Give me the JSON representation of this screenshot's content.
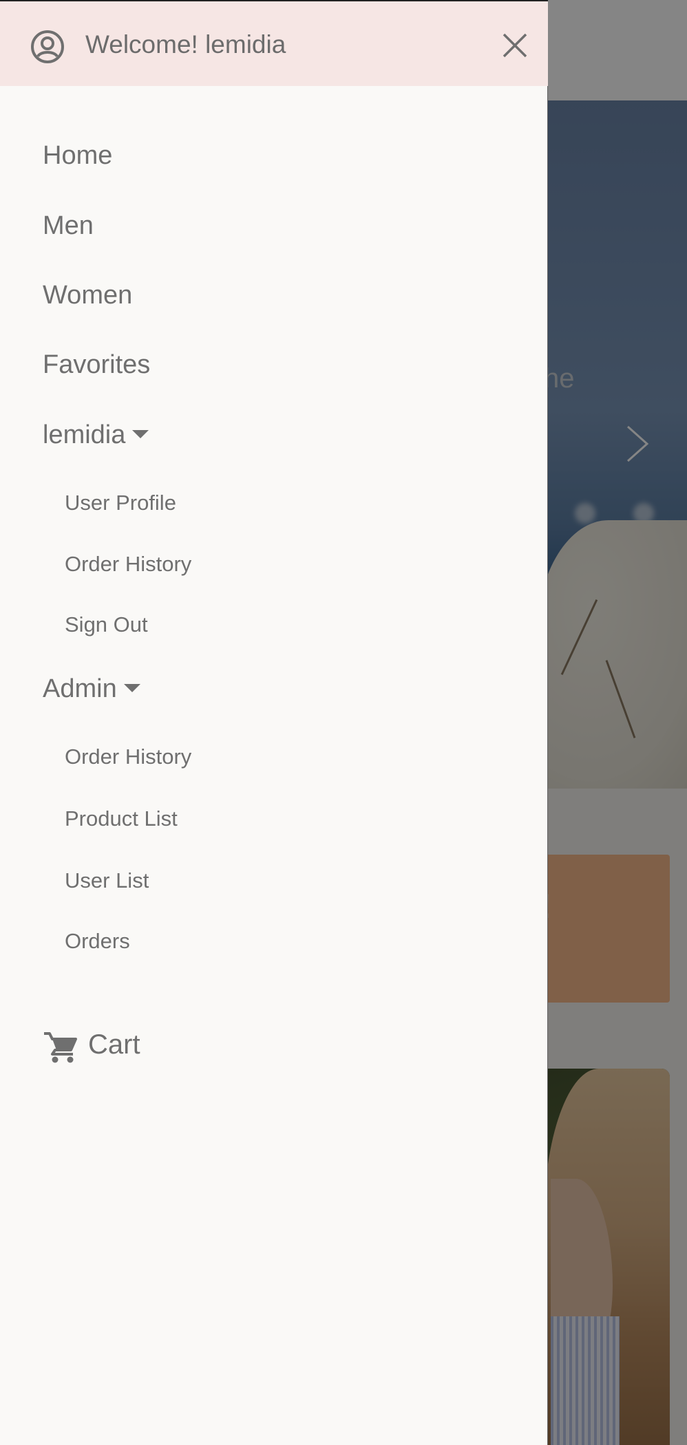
{
  "drawer": {
    "welcome": "Welcome! lemidia",
    "icons": {
      "account": "account-circle-icon",
      "close": "close-icon",
      "cart": "cart-icon",
      "caret": "caret-down-icon"
    },
    "nav": {
      "home": "Home",
      "men": "Men",
      "women": "Women",
      "favorites": "Favorites"
    },
    "user_menu": {
      "label": "lemidia",
      "items": [
        "User Profile",
        "Order History",
        "Sign Out"
      ]
    },
    "admin_menu": {
      "label": "Admin",
      "items": [
        "Order History",
        "Product List",
        "User List",
        "Orders"
      ]
    },
    "cart": "Cart",
    "colors": {
      "header_bg": "#f6e6e4",
      "drawer_bg": "#faf9f7",
      "text": "#6f6f6f"
    }
  },
  "background": {
    "hero_text_partial": "he",
    "promo_text_partial": "!",
    "icons": {
      "carousel_next": "chevron-right-icon"
    }
  }
}
